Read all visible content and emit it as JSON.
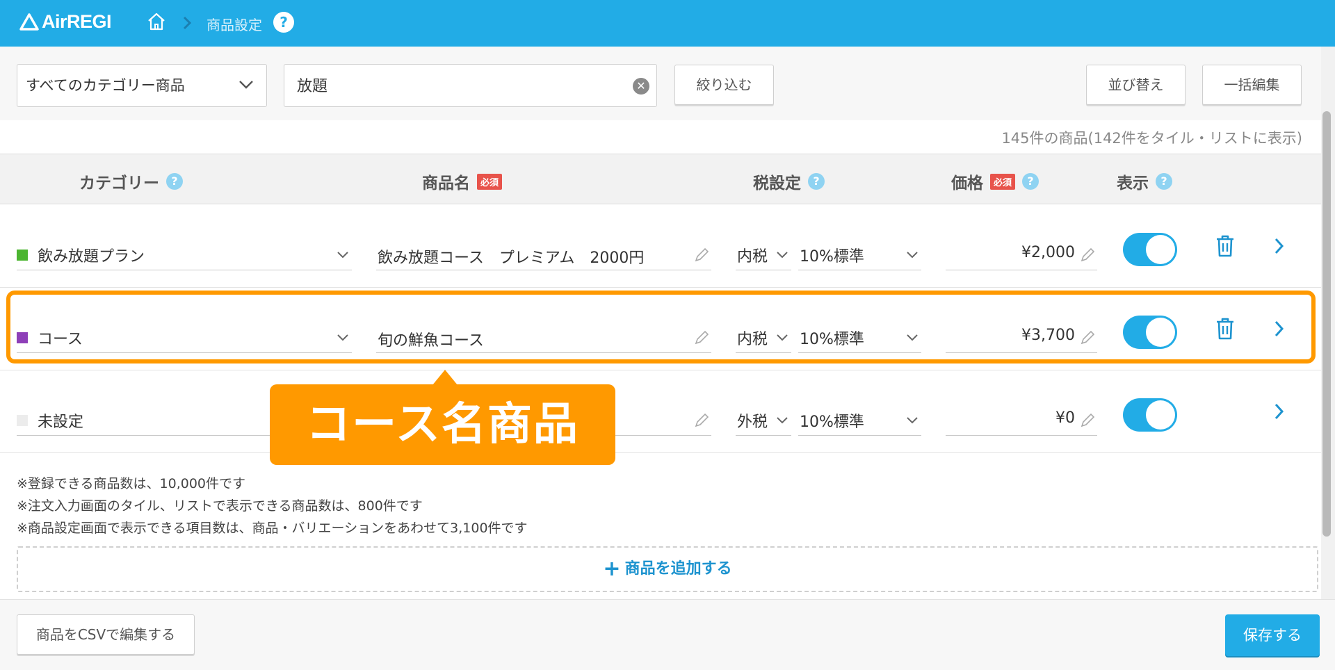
{
  "header": {
    "app_name": "AirREGI",
    "breadcrumb_current": "商品設定",
    "help": "?"
  },
  "toolbar": {
    "category_select": "すべてのカテゴリー商品",
    "search_value": "放題",
    "filter_label": "絞り込む",
    "sort_label": "並び替え",
    "bulk_edit_label": "一括編集"
  },
  "summary": {
    "count_text": "145件の商品(142件をタイル・リストに表示)"
  },
  "columns": {
    "category": "カテゴリー",
    "name": "商品名",
    "tax": "税設定",
    "price": "価格",
    "display": "表示",
    "required": "必須",
    "help": "?"
  },
  "rows": [
    {
      "category": "飲み放題プラン",
      "category_color": "#4cb531",
      "name": "飲み放題コース　プレミアム　2000円",
      "tax_type": "内税",
      "tax_rate": "10%標準",
      "price": "¥2,000",
      "display_on": true,
      "deletable": true
    },
    {
      "category": "コース",
      "category_color": "#8e3fb8",
      "name": "旬の鮮魚コース",
      "tax_type": "内税",
      "tax_rate": "10%標準",
      "price": "¥3,700",
      "display_on": true,
      "deletable": true
    },
    {
      "category": "未設定",
      "category_color": "#ececec",
      "name": "",
      "tax_type": "外税",
      "tax_rate": "10%標準",
      "price": "¥0",
      "display_on": true,
      "deletable": false
    }
  ],
  "callout": {
    "text": "コース名商品",
    "color": "#ff9900"
  },
  "notes": [
    "※登録できる商品数は、10,000件です",
    "※注文入力画面のタイル、リストで表示できる商品数は、800件です",
    "※商品設定画面で表示できる項目数は、商品・バリエーションをあわせて3,100件です"
  ],
  "add_product": {
    "plus": "+",
    "label": "商品を追加する"
  },
  "footer": {
    "csv_label": "商品をCSVで編集する",
    "save_label": "保存する"
  }
}
